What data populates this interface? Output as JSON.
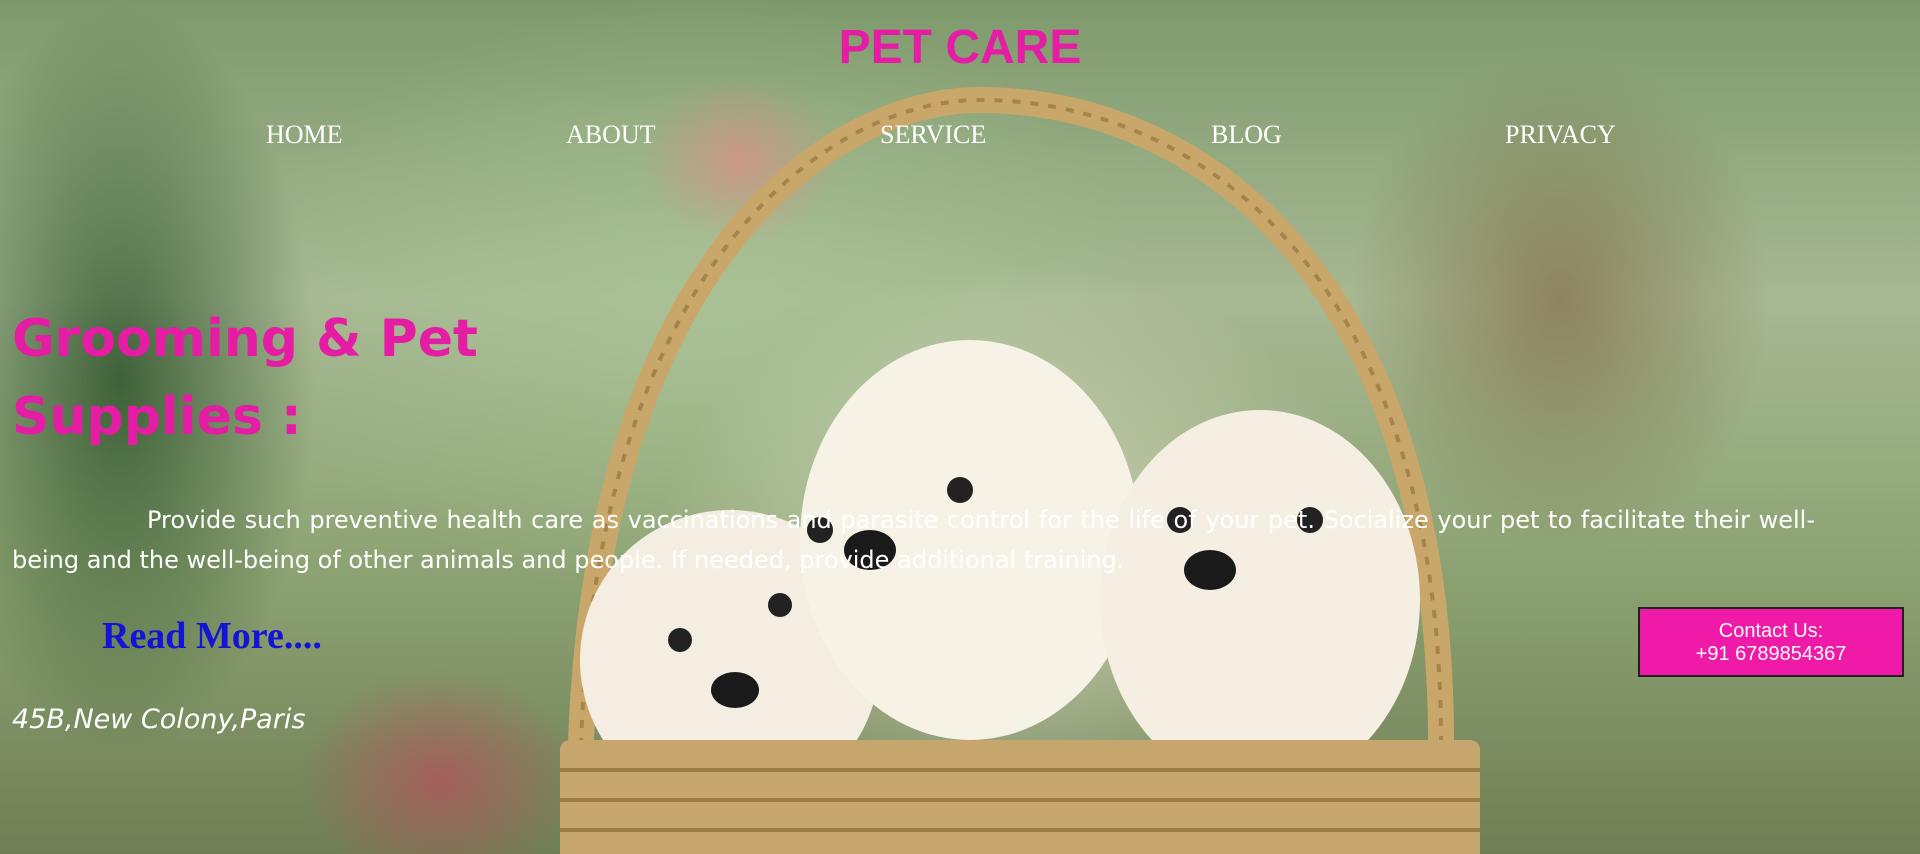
{
  "site": {
    "title": "PET CARE"
  },
  "nav": {
    "items": [
      {
        "label": "HOME"
      },
      {
        "label": "ABOUT"
      },
      {
        "label": "SERVICE"
      },
      {
        "label": "BLOG"
      },
      {
        "label": "PRIVACY"
      }
    ]
  },
  "hero": {
    "heading_line1": "Grooming & Pet",
    "heading_line2": "Supplies :",
    "paragraph": "Provide such preventive health care as vaccinations and parasite control for the life of your pet. Socialize your pet to facilitate their well-being and the well-being of other animals and people. If needed, provide additional training.",
    "read_more": "Read More....",
    "address": "45B,New Colony,Paris"
  },
  "contact": {
    "label": "Contact Us:",
    "phone": "+91 6789854367"
  },
  "colors": {
    "accent_pink": "#e51ca4",
    "link_blue": "#1414d6",
    "contact_bg": "#f01aa8"
  }
}
